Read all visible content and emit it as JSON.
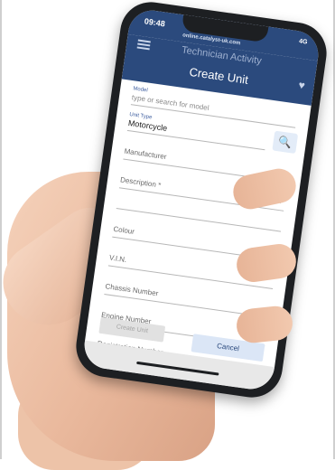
{
  "status_bar": {
    "time": "09:48",
    "url": "online.catalyst-uk.com",
    "network": "4G"
  },
  "app_bar": {
    "app_title": "Technician Activity",
    "page_title": "Create Unit"
  },
  "form": {
    "model": {
      "label": "Model",
      "placeholder": "type or search for model"
    },
    "unit_type": {
      "label": "Unit Type",
      "value": "Motorcycle"
    },
    "manufacturer": {
      "label": "Manufacturer"
    },
    "description": {
      "label": "Description *"
    },
    "colour": {
      "label": "Colour"
    },
    "vin": {
      "label": "V.I.N."
    },
    "chassis_number": {
      "label": "Chassis Number"
    },
    "engine_number": {
      "label": "Engine Number"
    },
    "registration_number": {
      "label": "Registration Number"
    }
  },
  "buttons": {
    "create_label": "Create Unit",
    "cancel_label": "Cancel"
  },
  "icons": {
    "menu": "menu-icon",
    "favourite": "heart-icon",
    "search": "search-icon",
    "dropdown": "chevron-down-icon"
  },
  "colors": {
    "primary": "#2b4a7d",
    "button_secondary_bg": "#dbe6f6",
    "button_disabled_bg": "#e1e1e1"
  }
}
